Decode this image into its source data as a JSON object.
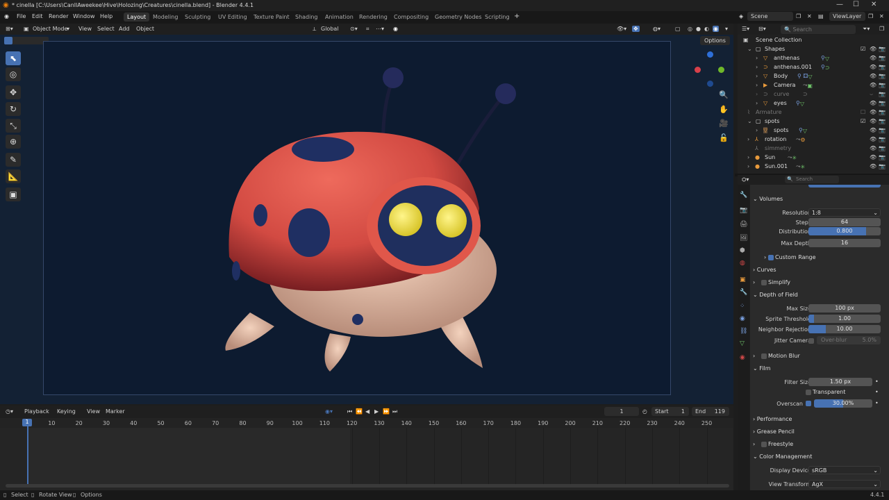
{
  "window": {
    "title": "* cinella [C:\\Users\\CanllAweekee\\Hive\\Holozing\\Creatures\\cinella.blend] - Blender 4.4.1"
  },
  "menu": [
    "File",
    "Edit",
    "Render",
    "Window",
    "Help"
  ],
  "workspaces": [
    "Layout",
    "Modeling",
    "Sculpting",
    "UV Editing",
    "Texture Paint",
    "Shading",
    "Animation",
    "Rendering",
    "Compositing",
    "Geometry Nodes",
    "Scripting"
  ],
  "scene": {
    "name": "Scene",
    "view_layer": "ViewLayer"
  },
  "viewport_header": {
    "mode": "Object Mode",
    "view": "View",
    "select": "Select",
    "add": "Add",
    "object": "Object",
    "orientation": "Global"
  },
  "viewport": {
    "options": "Options"
  },
  "timeline": {
    "playback": "Playback",
    "keying": "Keying",
    "view": "View",
    "marker": "Marker",
    "current_frame": "1",
    "start_label": "Start",
    "start": "1",
    "end_label": "End",
    "end": "119",
    "ticks": [
      "1",
      "10",
      "20",
      "30",
      "40",
      "50",
      "60",
      "70",
      "80",
      "90",
      "100",
      "110",
      "120",
      "130",
      "140",
      "150",
      "160",
      "170",
      "180",
      "190",
      "200",
      "210",
      "220",
      "230",
      "240",
      "250"
    ]
  },
  "outliner": {
    "search_placeholder": "Search",
    "rows": [
      {
        "label": "Scene Collection"
      },
      {
        "label": "Shapes"
      },
      {
        "label": "anthenas"
      },
      {
        "label": "anthenas.001"
      },
      {
        "label": "Body"
      },
      {
        "label": "Camera"
      },
      {
        "label": "curve"
      },
      {
        "label": "eyes"
      },
      {
        "label": "Armature"
      },
      {
        "label": "spots"
      },
      {
        "label": "spots"
      },
      {
        "label": "rotation"
      },
      {
        "label": "simmetry"
      },
      {
        "label": "Sun"
      },
      {
        "label": "Sun.001"
      }
    ]
  },
  "properties": {
    "search_placeholder": "Search",
    "volumes": {
      "title": "Volumes",
      "resolution_label": "Resolution",
      "resolution": "1:8",
      "steps_label": "Steps",
      "steps": "64",
      "distribution_label": "Distribution",
      "distribution": "0.800",
      "max_depth_label": "Max Depth",
      "max_depth": "16",
      "custom_range": "Custom Range"
    },
    "curves": "Curves",
    "simplify": "Simplify",
    "dof": {
      "title": "Depth of Field",
      "max_size_label": "Max Size",
      "max_size": "100 px",
      "sprite_label": "Sprite Threshold",
      "sprite": "1.00",
      "neighbor_label": "Neighbor Rejection",
      "neighbor": "10.00",
      "jitter_label": "Jitter Camera",
      "overblur_label": "Over-blur",
      "overblur": "5.0%"
    },
    "motion_blur": "Motion Blur",
    "film": {
      "title": "Film",
      "filter_label": "Filter Size",
      "filter": "1.50 px",
      "transparent": "Transparent",
      "overscan_label": "Overscan",
      "overscan": "30.00%"
    },
    "performance": "Performance",
    "grease_pencil": "Grease Pencil",
    "freestyle": "Freestyle",
    "color_management": {
      "title": "Color Management",
      "display_label": "Display Device",
      "display": "sRGB",
      "view_label": "View Transform",
      "view": "AgX"
    }
  },
  "status": {
    "select": "Select",
    "rotate": "Rotate View",
    "options": "Options",
    "version": "4.4.1"
  },
  "colors": {
    "accent": "#4772b3",
    "viewport_bg": "#132134",
    "ladybug_red": "#d9534a"
  }
}
